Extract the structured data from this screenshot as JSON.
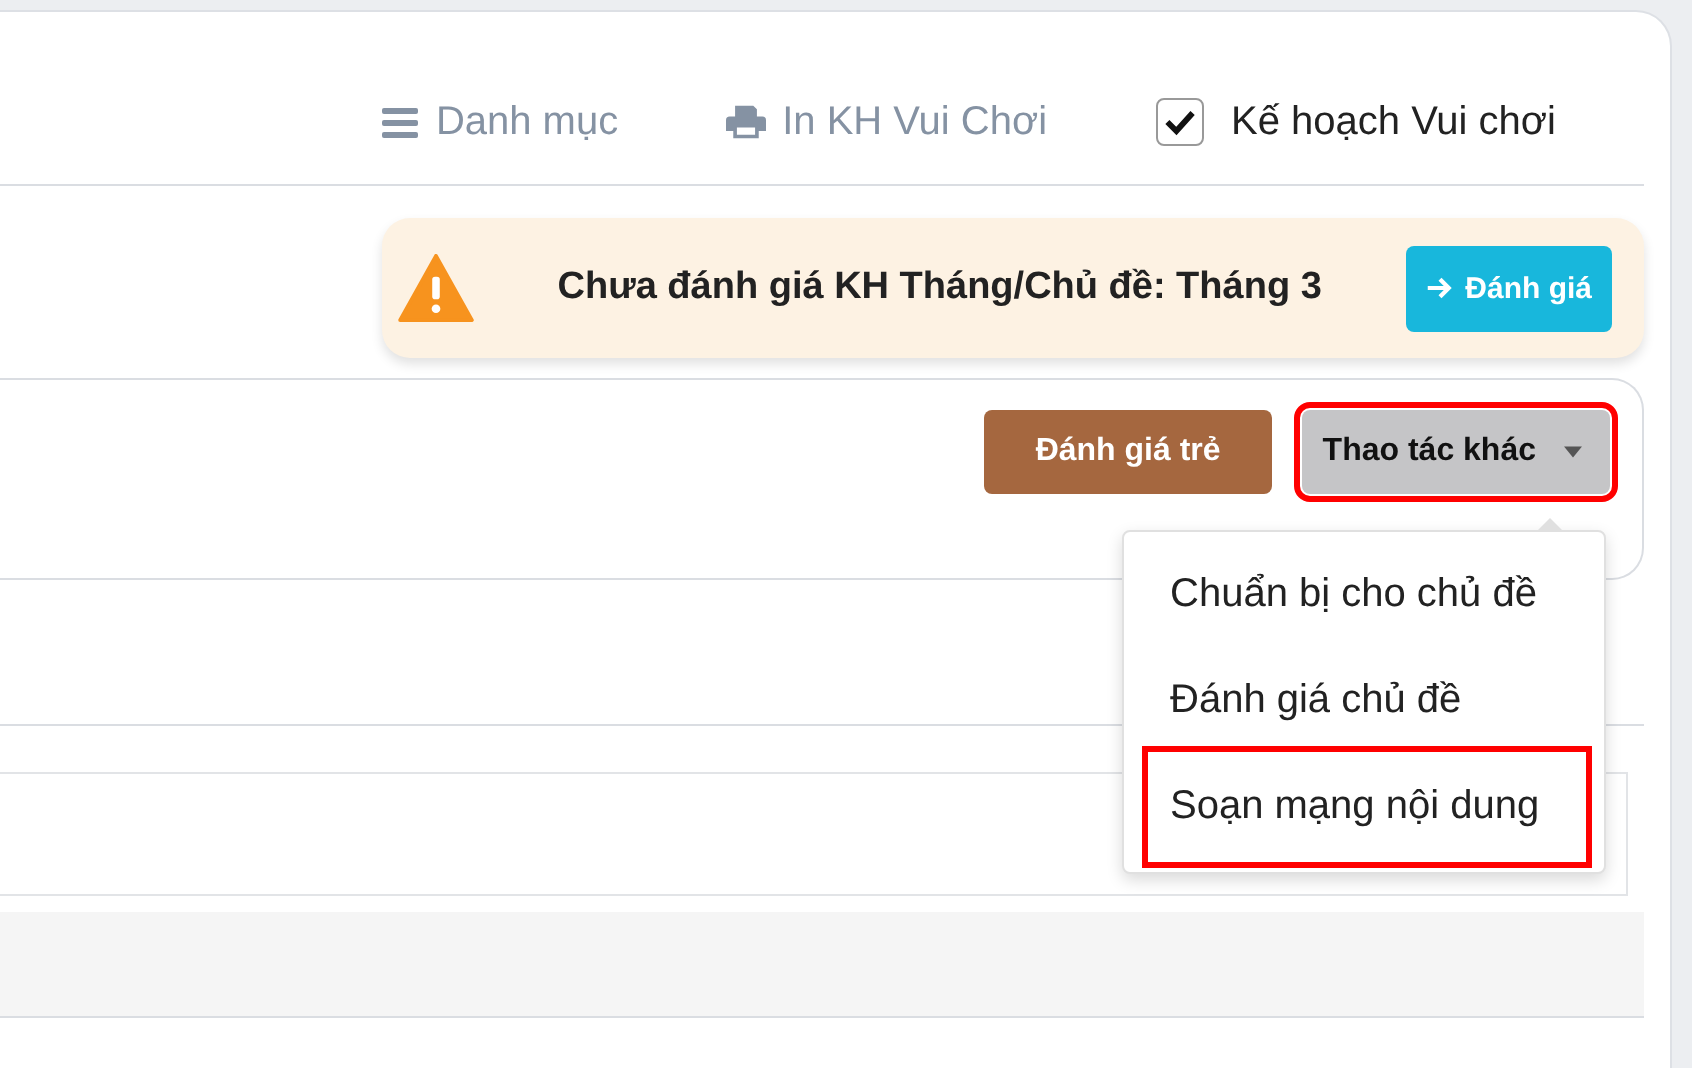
{
  "nav": {
    "items": [
      {
        "kind": "menu",
        "label": "Danh mục"
      },
      {
        "kind": "print",
        "label": "In KH Vui Chơi"
      }
    ],
    "checkbox": {
      "label": "Kế hoạch Vui chơi",
      "checked": true
    }
  },
  "alert": {
    "message": "Chưa đánh giá KH Tháng/Chủ đề: Tháng 3",
    "button": "Đánh giá"
  },
  "actions": {
    "buttons": [
      {
        "kind": "primary",
        "label": "Đánh giá trẻ",
        "highlighted": false
      },
      {
        "kind": "dropdown",
        "label": "Thao tác khác",
        "highlighted": true
      }
    ],
    "menu": {
      "items": [
        {
          "label": "Chuẩn bị cho chủ đề",
          "highlighted": false
        },
        {
          "label": "Đánh giá chủ đề",
          "highlighted": false
        },
        {
          "label": "Soạn mạng nội dung",
          "highlighted": true
        }
      ]
    }
  }
}
